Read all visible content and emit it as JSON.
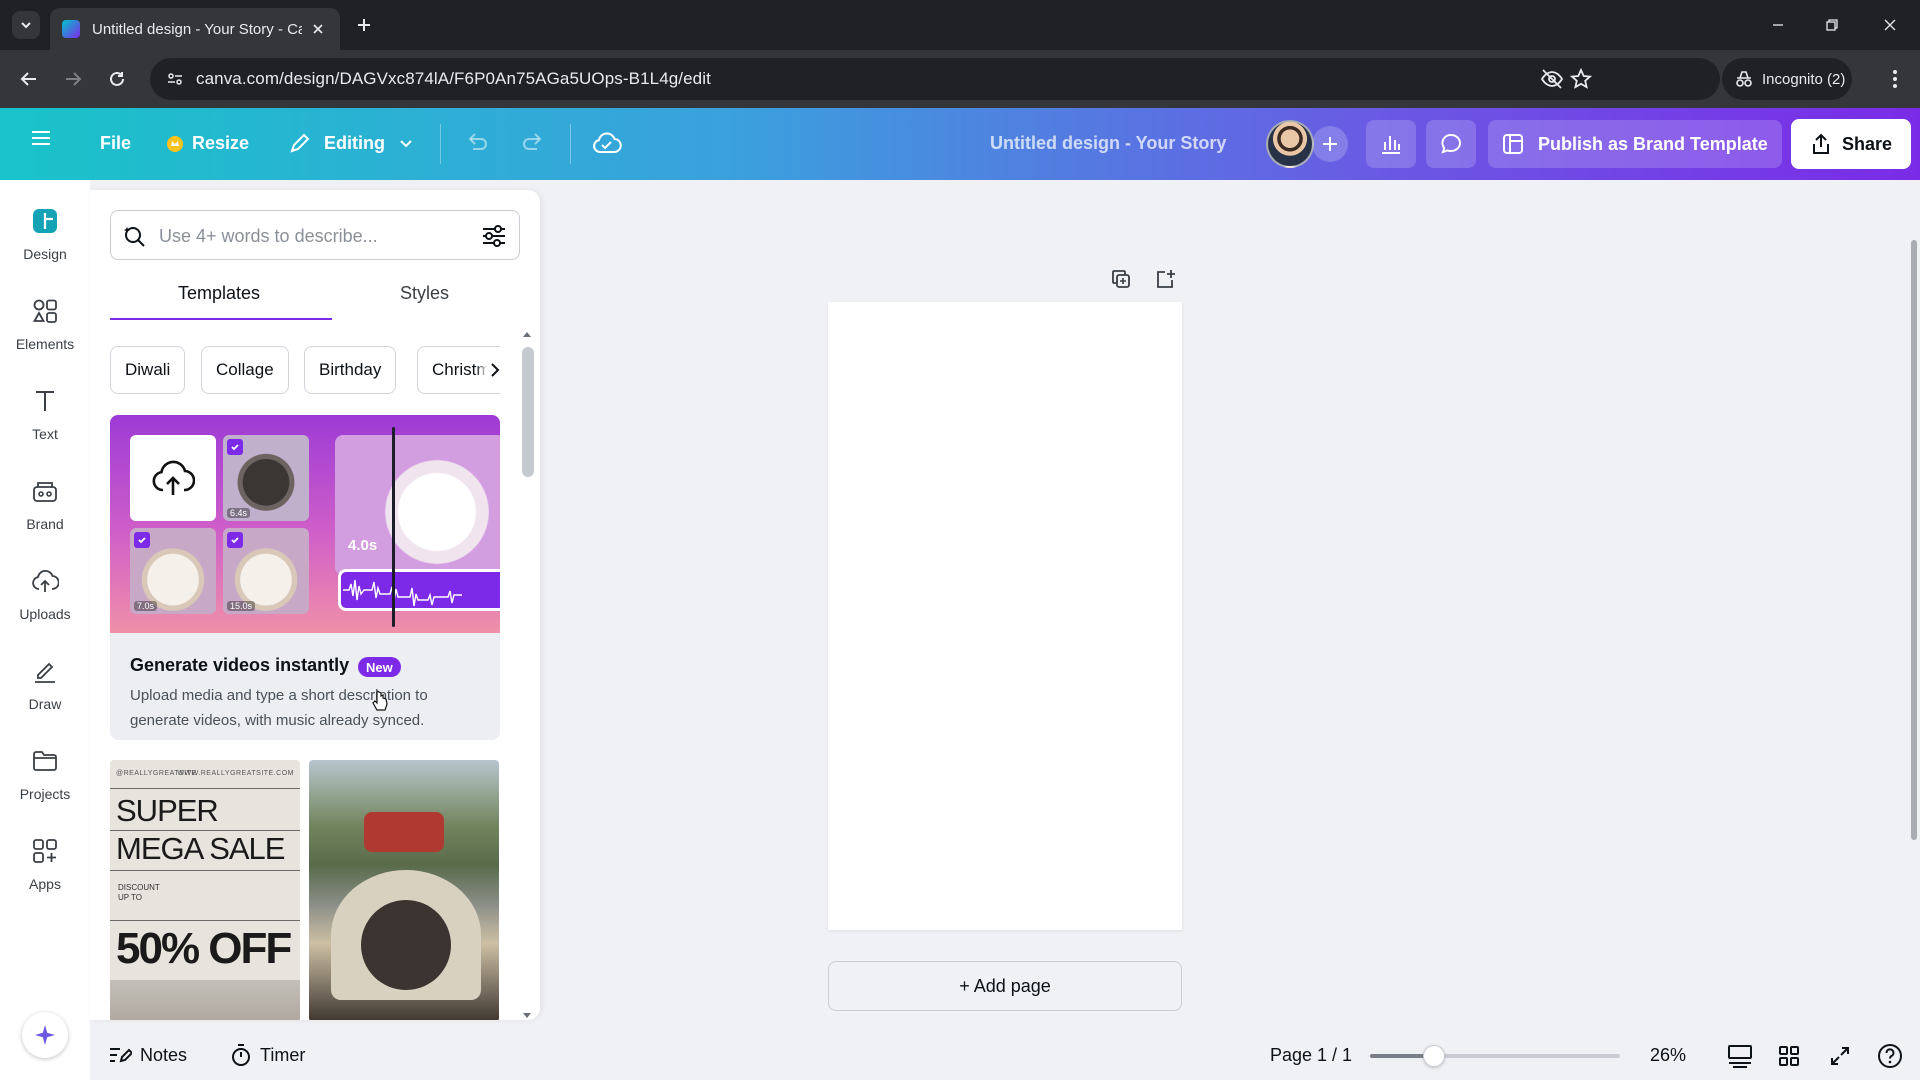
{
  "browser": {
    "tab_title": "Untitled design - Your Story - Canva",
    "url": "canva.com/design/DAGVxc874lA/F6P0An75AGa5UOps-B1L4g/edit",
    "incognito_label": "Incognito (2)"
  },
  "topbar": {
    "file": "File",
    "resize": "Resize",
    "editing": "Editing",
    "doc_title": "Untitled design - Your Story",
    "publish": "Publish as Brand Template",
    "share": "Share"
  },
  "rail": {
    "items": [
      {
        "label": "Design"
      },
      {
        "label": "Elements"
      },
      {
        "label": "Text"
      },
      {
        "label": "Brand"
      },
      {
        "label": "Uploads"
      },
      {
        "label": "Draw"
      },
      {
        "label": "Projects"
      },
      {
        "label": "Apps"
      }
    ]
  },
  "panel": {
    "search_placeholder": "Use 4+ words to describe...",
    "tabs": [
      "Templates",
      "Styles"
    ],
    "chips": [
      "Diwali",
      "Collage",
      "Birthday",
      "Christmas"
    ],
    "promo": {
      "title": "Generate videos instantly",
      "badge": "New",
      "description": "Upload media and type a short description to generate videos, with music already synced.",
      "durations": [
        "6.4s",
        "7.0s",
        "15.0s",
        "4.0s"
      ]
    },
    "templates": {
      "sale": {
        "tiny_left": "@REALLYGREATSITE",
        "tiny_right": "WWW.REALLYGREATSITE.COM",
        "line1": "SUPER",
        "line2": "MEGA SALE",
        "discount": "DISCOUNT\nUP TO",
        "percent": "50% OFF"
      }
    }
  },
  "canvas": {
    "add_page": "+ Add page"
  },
  "footer": {
    "notes": "Notes",
    "timer": "Timer",
    "page_indicator": "Page 1 / 1",
    "zoom": "26%",
    "zoom_fraction": 0.26
  },
  "colors": {
    "accent": "#7d2ae8",
    "topbar_start": "#19c3c9",
    "topbar_end": "#7a2be7"
  }
}
